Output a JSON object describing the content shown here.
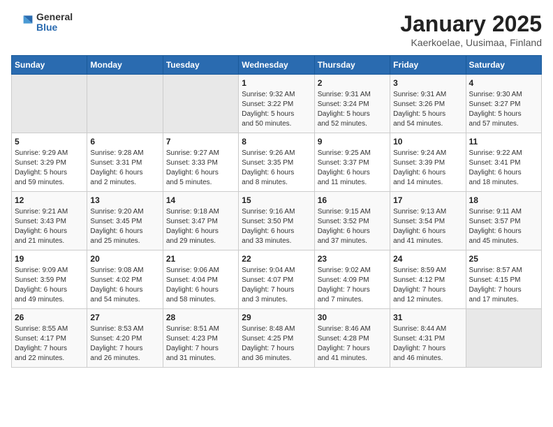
{
  "logo": {
    "general": "General",
    "blue": "Blue"
  },
  "header": {
    "title": "January 2025",
    "subtitle": "Kaerkoelae, Uusimaa, Finland"
  },
  "weekdays": [
    "Sunday",
    "Monday",
    "Tuesday",
    "Wednesday",
    "Thursday",
    "Friday",
    "Saturday"
  ],
  "weeks": [
    [
      {
        "day": "",
        "info": ""
      },
      {
        "day": "",
        "info": ""
      },
      {
        "day": "",
        "info": ""
      },
      {
        "day": "1",
        "info": "Sunrise: 9:32 AM\nSunset: 3:22 PM\nDaylight: 5 hours\nand 50 minutes."
      },
      {
        "day": "2",
        "info": "Sunrise: 9:31 AM\nSunset: 3:24 PM\nDaylight: 5 hours\nand 52 minutes."
      },
      {
        "day": "3",
        "info": "Sunrise: 9:31 AM\nSunset: 3:26 PM\nDaylight: 5 hours\nand 54 minutes."
      },
      {
        "day": "4",
        "info": "Sunrise: 9:30 AM\nSunset: 3:27 PM\nDaylight: 5 hours\nand 57 minutes."
      }
    ],
    [
      {
        "day": "5",
        "info": "Sunrise: 9:29 AM\nSunset: 3:29 PM\nDaylight: 5 hours\nand 59 minutes."
      },
      {
        "day": "6",
        "info": "Sunrise: 9:28 AM\nSunset: 3:31 PM\nDaylight: 6 hours\nand 2 minutes."
      },
      {
        "day": "7",
        "info": "Sunrise: 9:27 AM\nSunset: 3:33 PM\nDaylight: 6 hours\nand 5 minutes."
      },
      {
        "day": "8",
        "info": "Sunrise: 9:26 AM\nSunset: 3:35 PM\nDaylight: 6 hours\nand 8 minutes."
      },
      {
        "day": "9",
        "info": "Sunrise: 9:25 AM\nSunset: 3:37 PM\nDaylight: 6 hours\nand 11 minutes."
      },
      {
        "day": "10",
        "info": "Sunrise: 9:24 AM\nSunset: 3:39 PM\nDaylight: 6 hours\nand 14 minutes."
      },
      {
        "day": "11",
        "info": "Sunrise: 9:22 AM\nSunset: 3:41 PM\nDaylight: 6 hours\nand 18 minutes."
      }
    ],
    [
      {
        "day": "12",
        "info": "Sunrise: 9:21 AM\nSunset: 3:43 PM\nDaylight: 6 hours\nand 21 minutes."
      },
      {
        "day": "13",
        "info": "Sunrise: 9:20 AM\nSunset: 3:45 PM\nDaylight: 6 hours\nand 25 minutes."
      },
      {
        "day": "14",
        "info": "Sunrise: 9:18 AM\nSunset: 3:47 PM\nDaylight: 6 hours\nand 29 minutes."
      },
      {
        "day": "15",
        "info": "Sunrise: 9:16 AM\nSunset: 3:50 PM\nDaylight: 6 hours\nand 33 minutes."
      },
      {
        "day": "16",
        "info": "Sunrise: 9:15 AM\nSunset: 3:52 PM\nDaylight: 6 hours\nand 37 minutes."
      },
      {
        "day": "17",
        "info": "Sunrise: 9:13 AM\nSunset: 3:54 PM\nDaylight: 6 hours\nand 41 minutes."
      },
      {
        "day": "18",
        "info": "Sunrise: 9:11 AM\nSunset: 3:57 PM\nDaylight: 6 hours\nand 45 minutes."
      }
    ],
    [
      {
        "day": "19",
        "info": "Sunrise: 9:09 AM\nSunset: 3:59 PM\nDaylight: 6 hours\nand 49 minutes."
      },
      {
        "day": "20",
        "info": "Sunrise: 9:08 AM\nSunset: 4:02 PM\nDaylight: 6 hours\nand 54 minutes."
      },
      {
        "day": "21",
        "info": "Sunrise: 9:06 AM\nSunset: 4:04 PM\nDaylight: 6 hours\nand 58 minutes."
      },
      {
        "day": "22",
        "info": "Sunrise: 9:04 AM\nSunset: 4:07 PM\nDaylight: 7 hours\nand 3 minutes."
      },
      {
        "day": "23",
        "info": "Sunrise: 9:02 AM\nSunset: 4:09 PM\nDaylight: 7 hours\nand 7 minutes."
      },
      {
        "day": "24",
        "info": "Sunrise: 8:59 AM\nSunset: 4:12 PM\nDaylight: 7 hours\nand 12 minutes."
      },
      {
        "day": "25",
        "info": "Sunrise: 8:57 AM\nSunset: 4:15 PM\nDaylight: 7 hours\nand 17 minutes."
      }
    ],
    [
      {
        "day": "26",
        "info": "Sunrise: 8:55 AM\nSunset: 4:17 PM\nDaylight: 7 hours\nand 22 minutes."
      },
      {
        "day": "27",
        "info": "Sunrise: 8:53 AM\nSunset: 4:20 PM\nDaylight: 7 hours\nand 26 minutes."
      },
      {
        "day": "28",
        "info": "Sunrise: 8:51 AM\nSunset: 4:23 PM\nDaylight: 7 hours\nand 31 minutes."
      },
      {
        "day": "29",
        "info": "Sunrise: 8:48 AM\nSunset: 4:25 PM\nDaylight: 7 hours\nand 36 minutes."
      },
      {
        "day": "30",
        "info": "Sunrise: 8:46 AM\nSunset: 4:28 PM\nDaylight: 7 hours\nand 41 minutes."
      },
      {
        "day": "31",
        "info": "Sunrise: 8:44 AM\nSunset: 4:31 PM\nDaylight: 7 hours\nand 46 minutes."
      },
      {
        "day": "",
        "info": ""
      }
    ]
  ]
}
